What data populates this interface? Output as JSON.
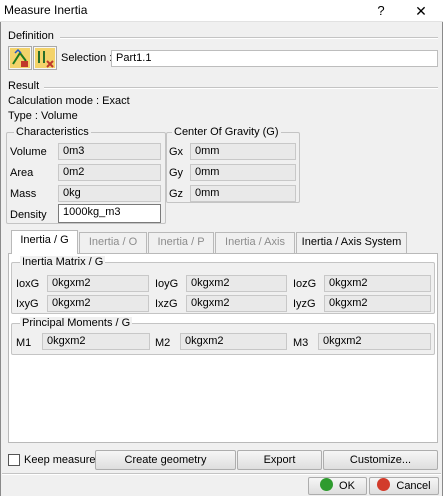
{
  "window": {
    "title": "Measure Inertia",
    "help_glyph": "?",
    "close_glyph": "✕"
  },
  "definition": {
    "legend": "Definition",
    "selection_label": "Selection :",
    "selection_value": "Part1.1"
  },
  "result": {
    "label": "Result",
    "calc_mode": "Calculation mode : Exact",
    "type": "Type : Volume"
  },
  "characteristics": {
    "legend": "Characteristics",
    "rows": [
      {
        "label": "Volume",
        "value": "0m3"
      },
      {
        "label": "Area",
        "value": "0m2"
      },
      {
        "label": "Mass",
        "value": "0kg"
      },
      {
        "label": "Density",
        "value": "1000kg_m3"
      }
    ]
  },
  "cog": {
    "legend": "Center Of Gravity (G)",
    "rows": [
      {
        "label": "Gx",
        "value": "0mm"
      },
      {
        "label": "Gy",
        "value": "0mm"
      },
      {
        "label": "Gz",
        "value": "0mm"
      }
    ]
  },
  "tabs": [
    {
      "label": "Inertia / G",
      "state": "active"
    },
    {
      "label": "Inertia / O",
      "state": "disabled"
    },
    {
      "label": "Inertia / P",
      "state": "disabled"
    },
    {
      "label": "Inertia / Axis",
      "state": "disabled"
    },
    {
      "label": "Inertia / Axis System",
      "state": "enabled"
    }
  ],
  "matrix": {
    "legend": "Inertia Matrix / G",
    "cells": [
      {
        "label": "IoxG",
        "value": "0kgxm2"
      },
      {
        "label": "IoyG",
        "value": "0kgxm2"
      },
      {
        "label": "IozG",
        "value": "0kgxm2"
      },
      {
        "label": "IxyG",
        "value": "0kgxm2"
      },
      {
        "label": "IxzG",
        "value": "0kgxm2"
      },
      {
        "label": "IyzG",
        "value": "0kgxm2"
      }
    ]
  },
  "principal": {
    "legend": "Principal Moments / G",
    "cells": [
      {
        "label": "M1",
        "value": "0kgxm2"
      },
      {
        "label": "M2",
        "value": "0kgxm2"
      },
      {
        "label": "M3",
        "value": "0kgxm2"
      }
    ]
  },
  "footer": {
    "keep_measure": "Keep measure",
    "create_geometry": "Create geometry",
    "export": "Export",
    "customize": "Customize...",
    "ok": "OK",
    "cancel": "Cancel"
  },
  "colors": {
    "ok_green": "#2e9b2e",
    "cancel_red": "#d23b2b",
    "titlebar": "#ffffff",
    "dialog_bg": "#f0f0f0"
  }
}
